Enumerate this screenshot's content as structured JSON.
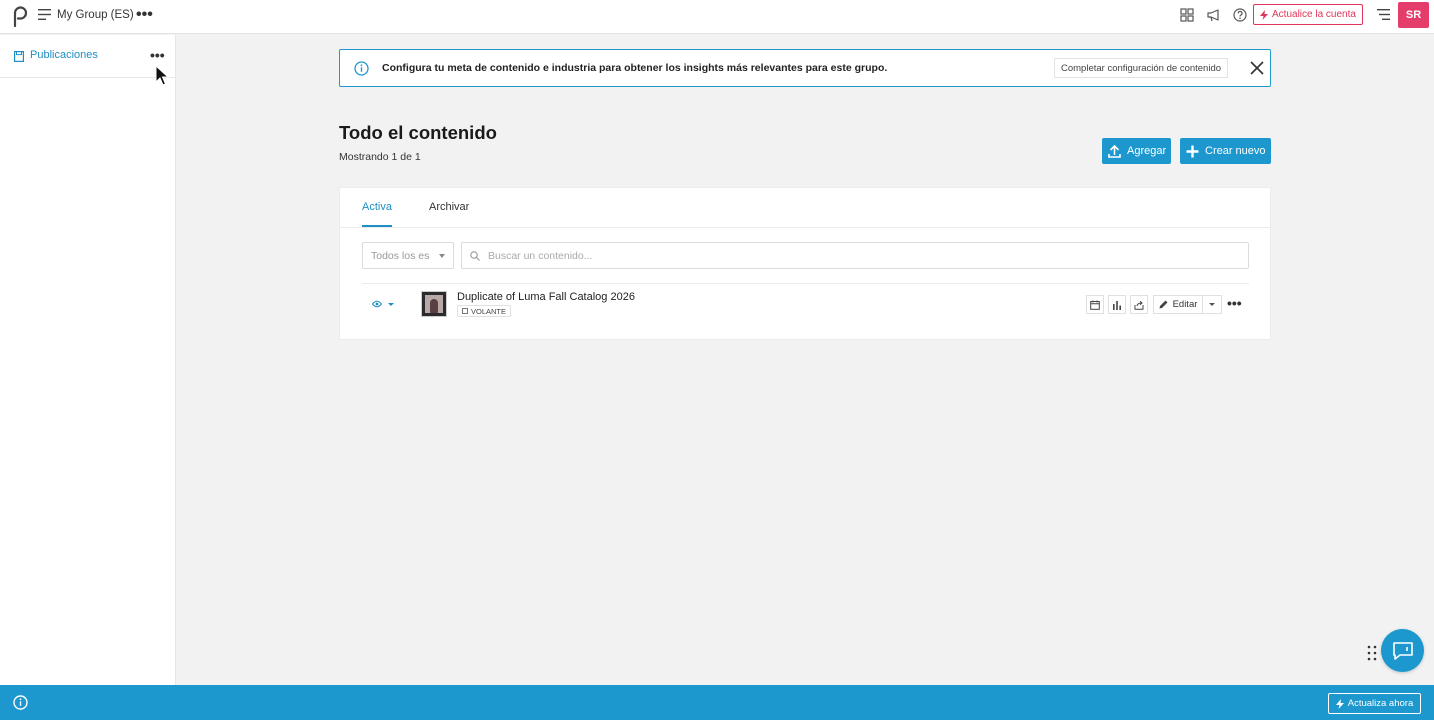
{
  "header": {
    "group_name": "My Group (ES)",
    "upgrade_label": "Actualice la cuenta",
    "avatar_initials": "SR"
  },
  "sidebar": {
    "items": [
      {
        "label": "Publicaciones"
      }
    ]
  },
  "banner": {
    "message": "Configura tu meta de contenido e industria para obtener los insights más relevantes para este grupo.",
    "config_label": "Completar configuración de contenido"
  },
  "main": {
    "title": "Todo el contenido",
    "subtitle": "Mostrando 1 de 1",
    "add_label": "Agregar",
    "new_label": "Crear nuevo",
    "tabs": [
      {
        "label": "Activa"
      },
      {
        "label": "Archivar"
      }
    ],
    "filter_value": "Todos los es",
    "search_placeholder": "Buscar un contenido...",
    "items": [
      {
        "title": "Duplicate of Luma Fall Catalog 2026",
        "badge": "VOLANTE",
        "edit_label": "Editar"
      }
    ]
  },
  "bottombar": {
    "upgrade_now_label": "Actualiza ahora"
  },
  "colors": {
    "accent": "#1c98cf",
    "brand_pink": "#e43c6b",
    "upgrade_red": "#e0355a"
  }
}
